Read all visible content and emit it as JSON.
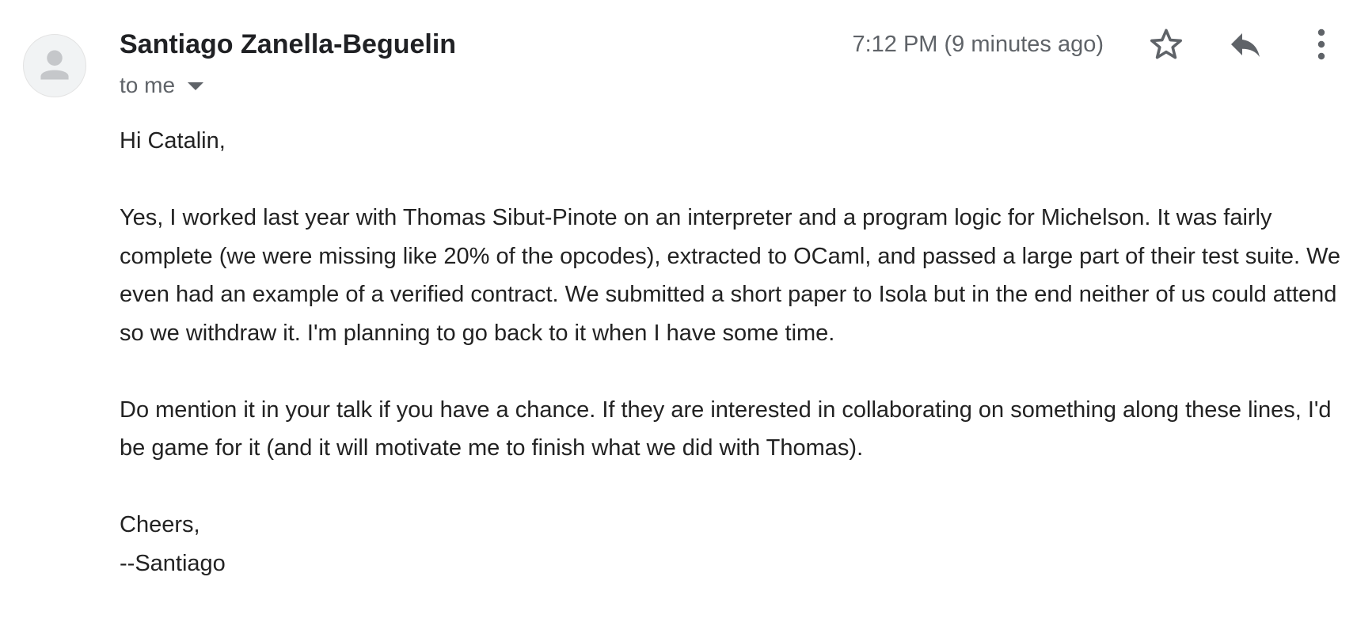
{
  "message": {
    "sender_name": "Santiago Zanella-Beguelin",
    "recipients_label": "to me",
    "timestamp": "7:12 PM (9 minutes ago)",
    "body": {
      "greeting": "Hi Catalin,",
      "paragraph_1": "Yes, I worked last year with Thomas Sibut-Pinote on an interpreter and a program logic for Michelson. It was fairly complete (we were missing like 20% of the opcodes), extracted to OCaml, and passed a large part of their test suite. We even had an example of a verified contract. We submitted a short paper to Isola but in the end neither of us could attend so we withdraw it. I'm planning to go back to it when I have some time.",
      "paragraph_2": "Do mention it in your talk if you have a chance. If they are interested in collaborating on something along these lines, I'd be game for it (and it will motivate me to finish what we did with Thomas).",
      "closing": "Cheers,\n--Santiago"
    }
  },
  "icons": {
    "avatar": "default-person-avatar",
    "star": "star-outline-icon",
    "reply": "reply-icon",
    "more": "more-vert-icon",
    "recipients_caret": "caret-down-icon"
  },
  "colors": {
    "text_primary": "#202124",
    "text_secondary": "#5f6368",
    "icon": "#5f6368",
    "avatar_bg": "#f1f3f4",
    "avatar_glyph": "#c5c7ca"
  }
}
